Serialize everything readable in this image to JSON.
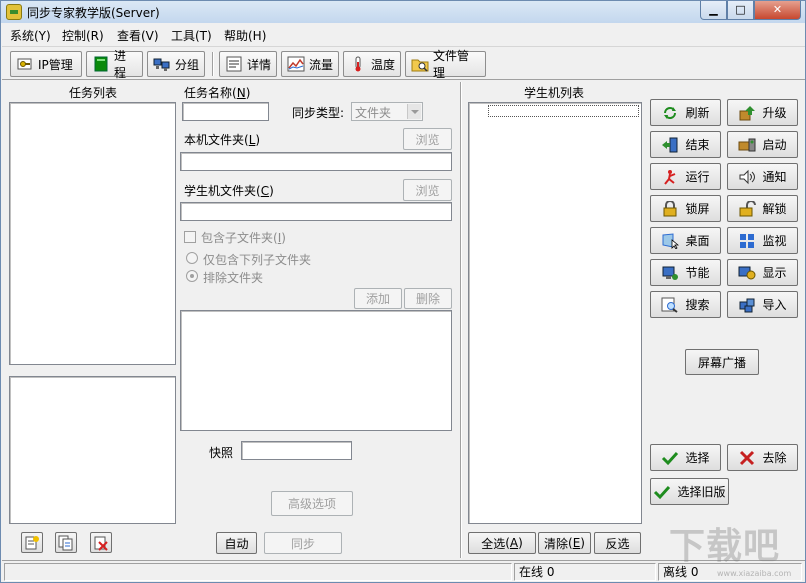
{
  "window": {
    "title": "同步专家教学版(Server)",
    "min": "0",
    "max": "1",
    "close": "r"
  },
  "menu": [
    "系统(Y)",
    "控制(R)",
    "查看(V)",
    "工具(T)",
    "帮助(H)"
  ],
  "toolbar": {
    "ip": "IP管理",
    "process": "进程",
    "group": "分组",
    "details": "详情",
    "traffic": "流量",
    "temperature": "温度",
    "files": "文件管理"
  },
  "left": {
    "task_list_title": "任务列表"
  },
  "middle": {
    "task_name_label": "任务名称",
    "task_name_key": "N",
    "sync_type_label": "同步类型:",
    "sync_type_value": "文件夹",
    "local_folder_label": "本机文件夹",
    "local_folder_key": "L",
    "student_folder_label": "学生机文件夹",
    "student_folder_key": "C",
    "browse": "浏览",
    "include_subfolders": "包含子文件夹",
    "include_subfolders_key": "I",
    "only_include": "仅包含下列子文件夹",
    "exclude": "排除文件夹",
    "add": "添加",
    "delete": "删除",
    "snapshot_label": "快照",
    "advanced": "高级选项",
    "auto": "自动",
    "sync": "同步"
  },
  "student": {
    "title": "学生机列表",
    "select_all": "全选",
    "select_all_key": "A",
    "clear": "清除",
    "clear_key": "E",
    "invert": "反选"
  },
  "actions": {
    "refresh": "刷新",
    "upgrade": "升级",
    "end": "结束",
    "start": "启动",
    "run": "运行",
    "notify": "通知",
    "lock": "锁屏",
    "unlock": "解锁",
    "desktop": "桌面",
    "monitor": "监视",
    "power": "节能",
    "display": "显示",
    "search": "搜索",
    "import": "导入",
    "broadcast": "屏幕广播",
    "choose": "选择",
    "remove": "去除",
    "choose_old": "选择旧版"
  },
  "status": {
    "online": "在线 0",
    "offline": "离线 0"
  },
  "watermark": {
    "main": "下载吧",
    "sub": "www.xiazaiba.com"
  }
}
